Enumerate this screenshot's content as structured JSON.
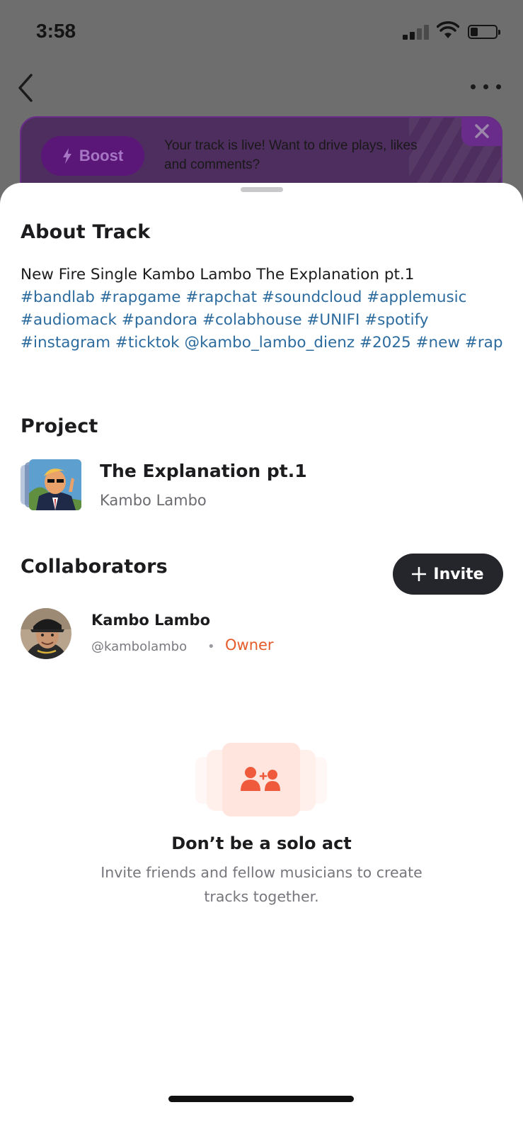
{
  "status_bar": {
    "time": "3:58"
  },
  "header": {
    "back_icon": "chevron-left-icon",
    "more_icon": "ellipsis-icon"
  },
  "boost_banner": {
    "button_label": "Boost",
    "message": "Your track is live! Want to drive plays, likes and comments?",
    "close_icon": "close-icon"
  },
  "about": {
    "title": "About Track",
    "description": "New Fire Single Kambo Lambo The Explanation pt.1",
    "tags": [
      "#bandlab",
      "#rapgame",
      "#rapchat",
      "#soundcloud",
      "#applemusic",
      "#audiomack",
      "#pandora",
      "#colabhouse",
      "#UNIFI",
      "#spotify",
      "#instagram",
      "#ticktok",
      "@kambo_lambo_dienz",
      "#2025",
      "#new",
      "#rap"
    ]
  },
  "project": {
    "title": "Project",
    "name": "The Explanation pt.1",
    "artist": "Kambo Lambo"
  },
  "collaborators": {
    "title": "Collaborators",
    "invite_label": "Invite",
    "items": [
      {
        "name": "Kambo Lambo",
        "handle": "@kambolambo",
        "role": "Owner"
      }
    ]
  },
  "empty_state": {
    "icon": "add-users-icon",
    "title": "Don’t be a solo act",
    "description": "Invite friends and fellow musicians to create tracks together."
  },
  "colors": {
    "accent_orange": "#e45c2a",
    "hashtag_blue": "#2c6b9e",
    "invite_dark": "#25262b",
    "boost_purple": "#5a1778"
  }
}
